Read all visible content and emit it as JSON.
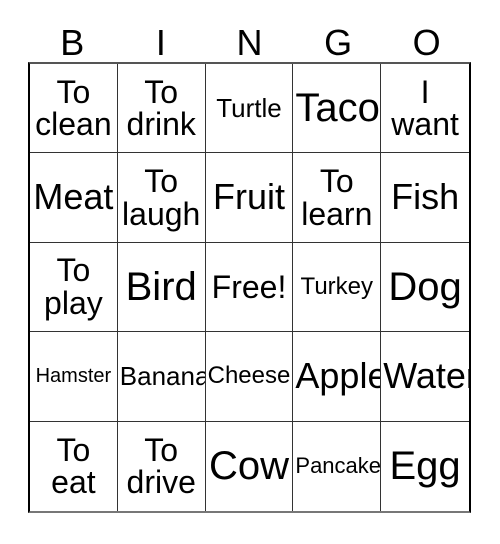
{
  "card": {
    "title_letters": [
      "B",
      "I",
      "N",
      "G",
      "O"
    ],
    "free_space_label": "Free!",
    "background_color": "#ffffff",
    "text_color": "#000000",
    "border_color": "#000000",
    "rows": 5,
    "columns": 5,
    "cells": [
      [
        {
          "text": "To\nclean",
          "size": "lg"
        },
        {
          "text": "To\ndrink",
          "size": "lg"
        },
        {
          "text": "Turtle",
          "size": "md"
        },
        {
          "text": "Taco",
          "size": "xxl"
        },
        {
          "text": "I\nwant",
          "size": "lg"
        }
      ],
      [
        {
          "text": "Meat",
          "size": "xl"
        },
        {
          "text": "To\nlaugh",
          "size": "lg"
        },
        {
          "text": "Fruit",
          "size": "xl"
        },
        {
          "text": "To\nlearn",
          "size": "lg"
        },
        {
          "text": "Fish",
          "size": "xl"
        }
      ],
      [
        {
          "text": "To\nplay",
          "size": "lg"
        },
        {
          "text": "Bird",
          "size": "xxl"
        },
        {
          "text": "Free!",
          "size": "lg"
        },
        {
          "text": "Turkey",
          "size": "sm"
        },
        {
          "text": "Dog",
          "size": "xxl"
        }
      ],
      [
        {
          "text": "Hamster",
          "size": "xs"
        },
        {
          "text": "Banana",
          "size": "md"
        },
        {
          "text": "Cheese",
          "size": "sm"
        },
        {
          "text": "Apple",
          "size": "xl"
        },
        {
          "text": "Water",
          "size": "xl"
        }
      ],
      [
        {
          "text": "To\neat",
          "size": "lg"
        },
        {
          "text": "To\ndrive",
          "size": "lg"
        },
        {
          "text": "Cow",
          "size": "xxl"
        },
        {
          "text": "Pancake",
          "size": "s"
        },
        {
          "text": "Egg",
          "size": "xxl"
        }
      ]
    ]
  }
}
